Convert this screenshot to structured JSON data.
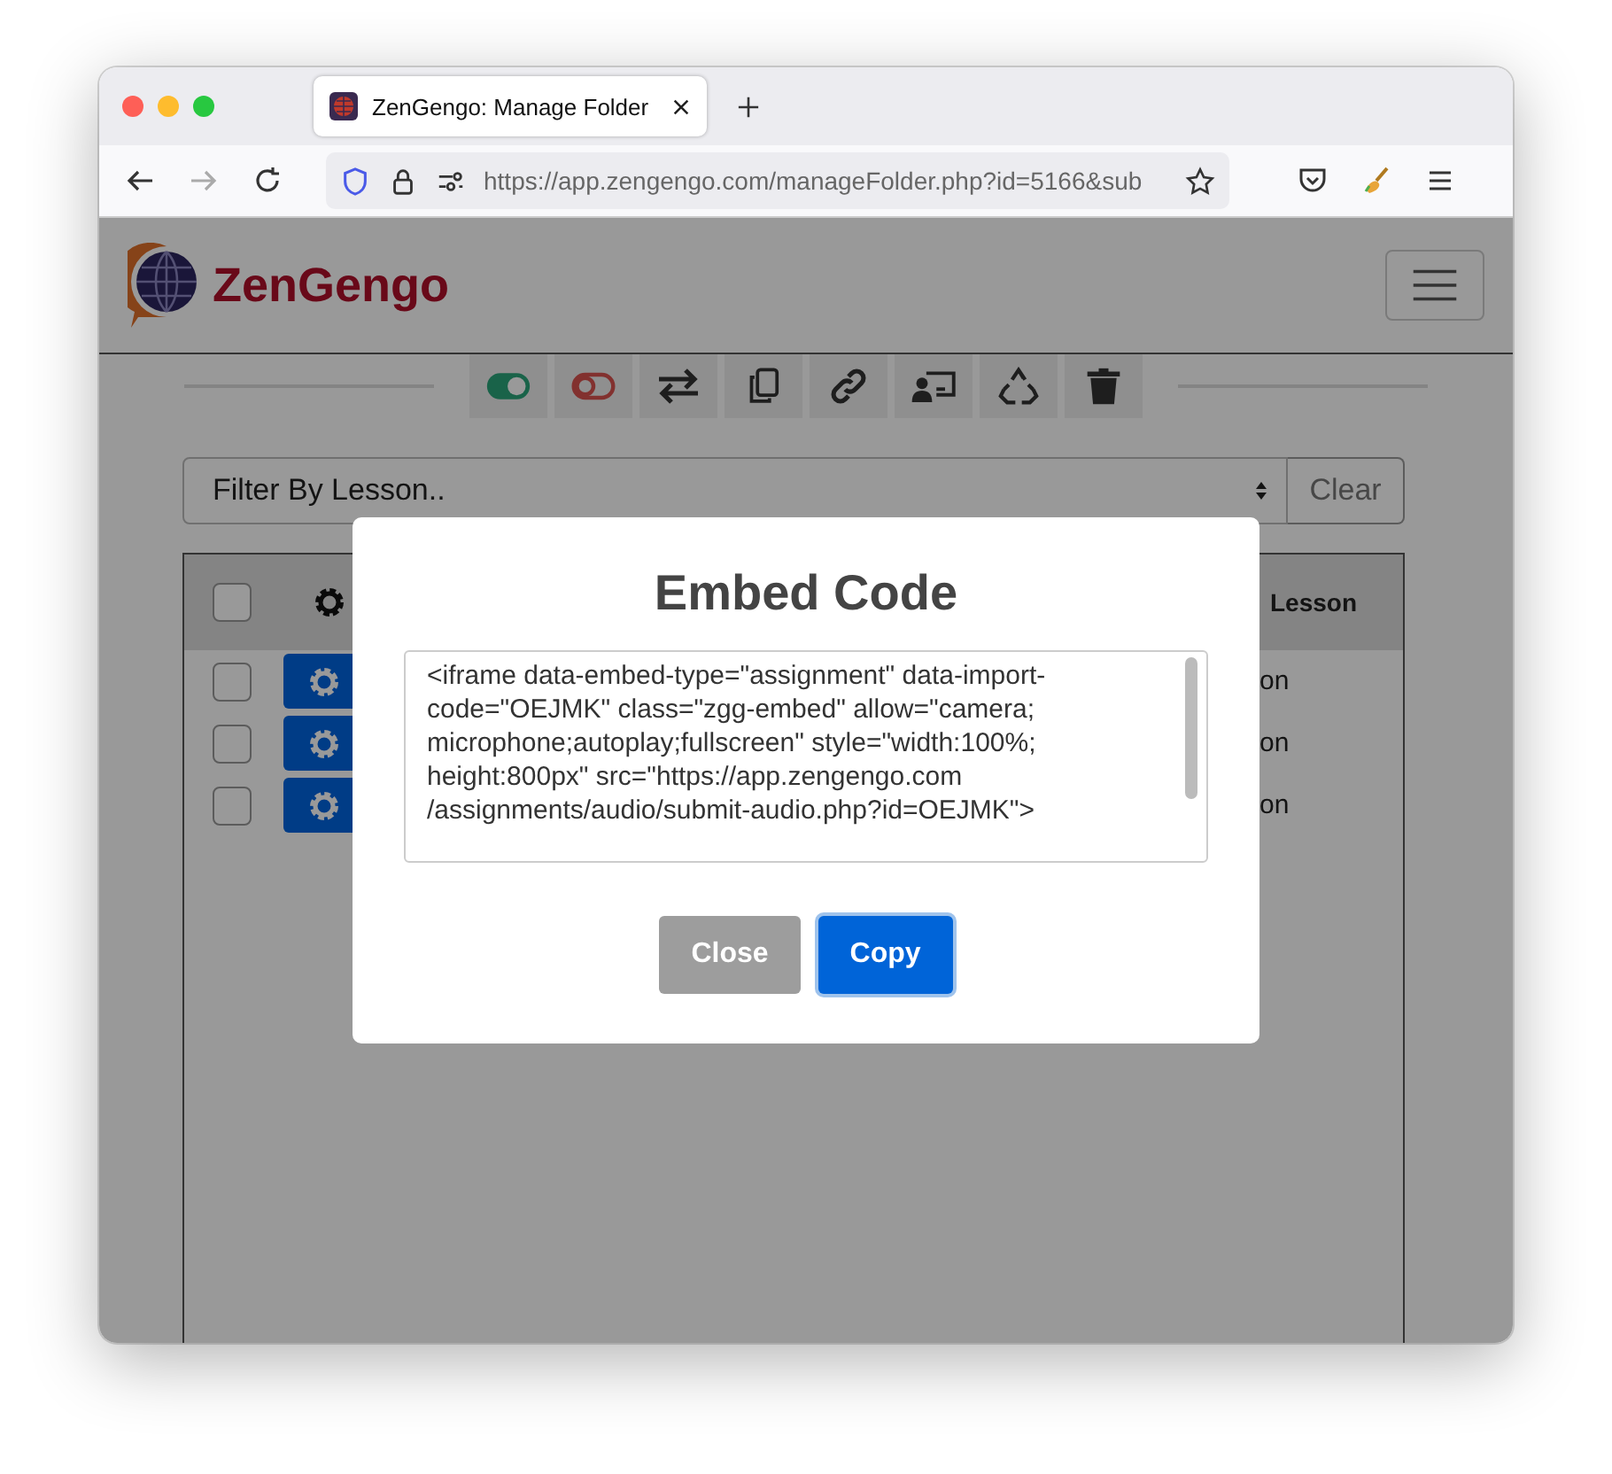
{
  "browser": {
    "tab_title": "ZenGengo: Manage Folder",
    "url_host": "https://app.zengengo.com",
    "url_path": "/manageFolder.php?id=5166&sub"
  },
  "header": {
    "logo_text": "ZenGengo"
  },
  "filter": {
    "placeholder": "Filter By Lesson..",
    "clear_label": "Clear"
  },
  "table": {
    "header_checked": false,
    "column_3": "Lesson",
    "rows": [
      {
        "checked": false,
        "column_3": "on"
      },
      {
        "checked": false,
        "column_3": "on"
      },
      {
        "checked": false,
        "column_3": "on"
      }
    ]
  },
  "modal": {
    "title": "Embed Code",
    "code": "<iframe data-embed-type=\"assignment\" data-import-code=\"OEJMK\" class=\"zgg-embed\" allow=\"camera; microphone;autoplay;fullscreen\" style=\"width:100%; height:800px\" src=\"https://app.zengengo.com /assignments/audio/submit-audio.php?id=OEJMK\">",
    "buttons": [
      {
        "label": "Close",
        "kind": "secondary"
      },
      {
        "label": "Copy",
        "kind": "primary"
      }
    ]
  }
}
